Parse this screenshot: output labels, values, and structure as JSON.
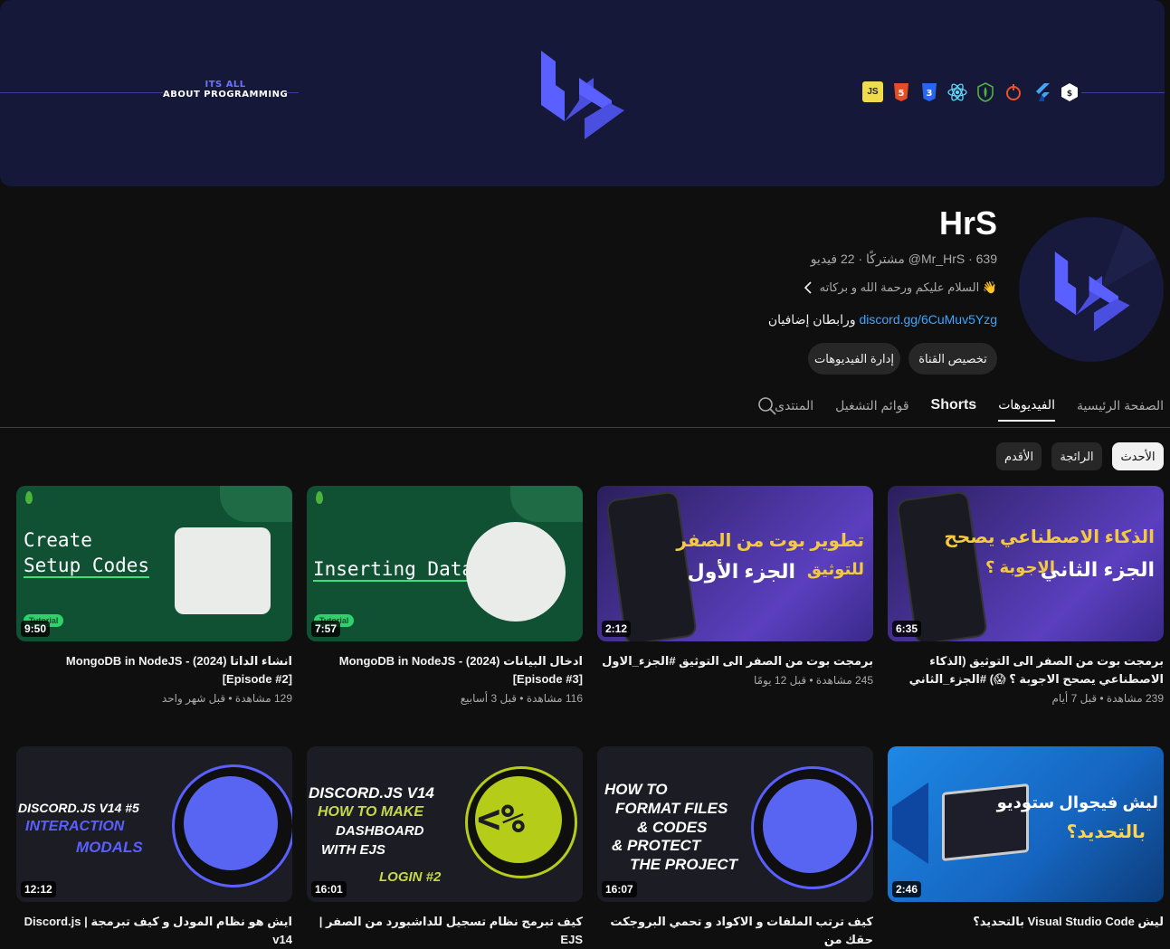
{
  "banner": {
    "tagline_top": "ITS ALL",
    "tagline_bottom": "ABOUT PROGRAMMING",
    "tech_icons": [
      "js-icon",
      "html5-icon",
      "css3-icon",
      "react-icon",
      "mongodb-icon",
      "nodejs-icon",
      "flutter-icon",
      "bootstrap-icon"
    ]
  },
  "channel": {
    "name": "HrS",
    "meta": "‎@Mr_HrS · 639 مشتركًا · 22 فيديو",
    "description": "👋 السلام عليكم ورحمة الله و بركاته",
    "link_text": "discord.gg/6CuMuv5Yzg",
    "link_suffix": " ورابطان إضافيان",
    "customize_label": "تخصيص القناة",
    "manage_label": "إدارة الفيديوهات"
  },
  "tabs": [
    "الصفحة الرئيسية",
    "الفيديوهات",
    "Shorts",
    "قوائم التشغيل",
    "المنتدى"
  ],
  "chips": [
    "الأحدث",
    "الرائجة",
    "الأقدم"
  ],
  "videos": [
    {
      "title": "برمجت بوت من الصفر الى التوثيق (الذكاء الاصطناعي يصحح الاجوبة ؟ 😱) #الجزء_الثاني",
      "meta": "239 مشاهدة • قبل 7 أيام",
      "duration": "6:35"
    },
    {
      "title": "برمجت بوت من الصفر الى التوثيق #الجزء_الاول",
      "meta": "245 مشاهدة • قبل 12 يومًا",
      "duration": "2:12"
    },
    {
      "title": "ادخال البيانات (2024) - MongoDB in NodeJS [Episode #3]",
      "meta": "116 مشاهدة • قبل 3 أسابيع",
      "duration": "7:57"
    },
    {
      "title": "انشاء الداتا (2024) - MongoDB in NodeJS [Episode #2]",
      "meta": "129 مشاهدة • قبل شهر واحد",
      "duration": "9:50"
    },
    {
      "title": "ليش Visual Studio Code بالتحديد؟",
      "meta": "",
      "duration": "2:46"
    },
    {
      "title": "كيف ترتب الملفات و الاكواد و تحمي البروجكت حقك من",
      "meta": "",
      "duration": "16:07"
    },
    {
      "title": "كيف تبرمج نظام تسجيل للداشبورد من الصفر | EJS",
      "meta": "",
      "duration": "16:01"
    },
    {
      "title": "ايش هو نظام المودل و كيف تبرمجة | Discord.js v14",
      "meta": "",
      "duration": "12:12"
    }
  ],
  "thumb_text": {
    "v1_l1": "الذكاء الاصطناعي يصحح",
    "v1_l2": "الاجوبة ؟",
    "v1_l3": "الجزء الثاني",
    "v2_l1": "تطوير بوت من الصفر",
    "v2_l2": "للتوثيق",
    "v2_l3": "الجزء الأول",
    "v3": "Inserting Data",
    "v4_l1": "Create",
    "v4_l2": "Setup Codes",
    "badge": "Tutorial",
    "v5_l1": "ليش فيجوال ستوديو",
    "v5_l2": "بالتحديد؟",
    "v6_l1": "HOW TO",
    "v6_l2": "FORMAT FILES",
    "v6_l3": "& CODES",
    "v6_l4": "& PROTECT",
    "v6_l5": "THE PROJECT",
    "v7_l1": "DISCORD.JS V14",
    "v7_l2": "HOW TO MAKE",
    "v7_l3": "DASHBOARD",
    "v7_l4": "WITH EJS",
    "v7_l5": "LOGIN #2",
    "v8_l1": "DISCORD.JS V14 #5",
    "v8_l2": "INTERACTION",
    "v8_l3": "MODALS"
  }
}
